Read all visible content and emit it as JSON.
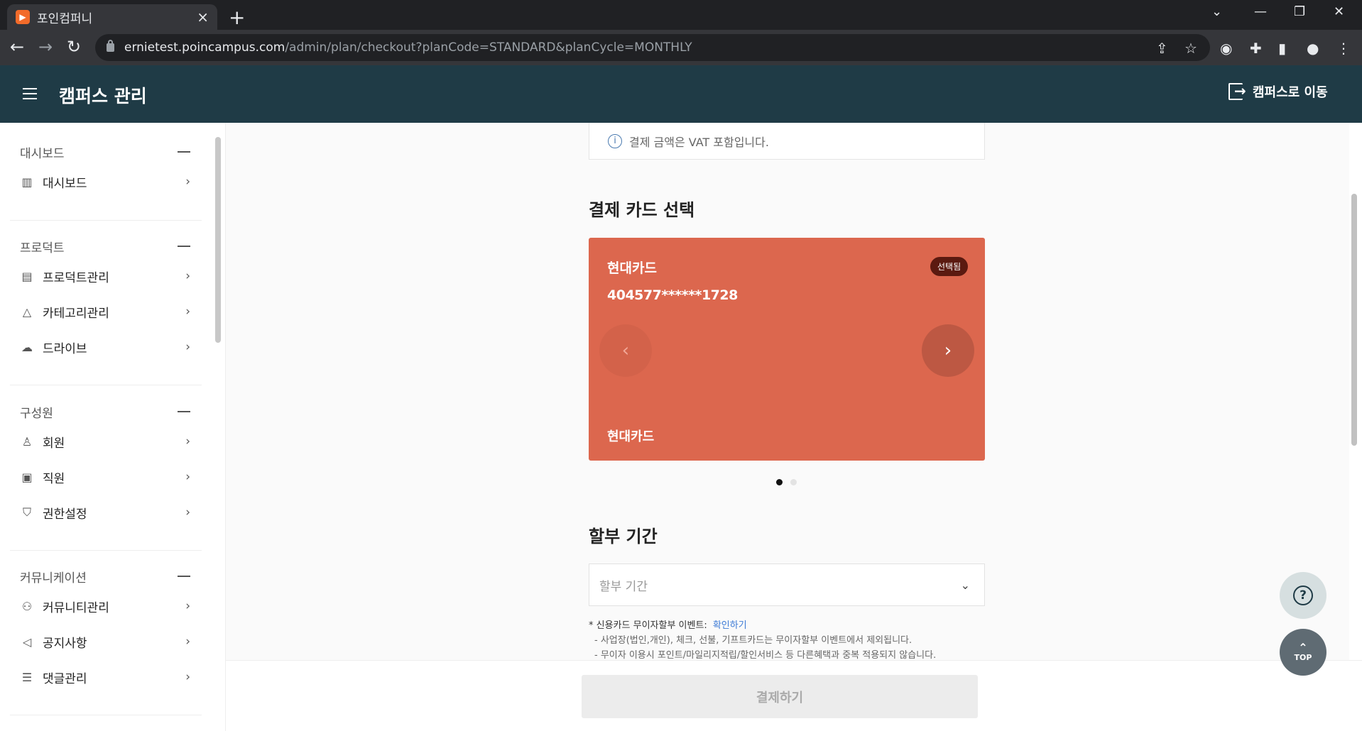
{
  "browser": {
    "tab_title": "포인컴퍼니",
    "url_host": "ernietest.poincampus.com",
    "url_path": "/admin/plan/checkout?planCode=STANDARD&planCycle=MONTHLY"
  },
  "header": {
    "title": "캠퍼스 관리",
    "goto_label": "캠퍼스로 이동"
  },
  "sidebar": {
    "groups": [
      {
        "title": "대시보드",
        "items": [
          {
            "label": "대시보드",
            "icon": "bar-chart-icon"
          }
        ]
      },
      {
        "title": "프로덕트",
        "items": [
          {
            "label": "프로덕트관리",
            "icon": "product-icon"
          },
          {
            "label": "카테고리관리",
            "icon": "category-icon"
          },
          {
            "label": "드라이브",
            "icon": "cloud-icon"
          }
        ]
      },
      {
        "title": "구성원",
        "items": [
          {
            "label": "회원",
            "icon": "member-icon"
          },
          {
            "label": "직원",
            "icon": "staff-icon"
          },
          {
            "label": "권한설정",
            "icon": "shield-icon"
          }
        ]
      },
      {
        "title": "커뮤니케이션",
        "items": [
          {
            "label": "커뮤니티관리",
            "icon": "community-icon"
          },
          {
            "label": "공지사항",
            "icon": "megaphone-icon"
          },
          {
            "label": "댓글관리",
            "icon": "comment-icon"
          }
        ]
      }
    ]
  },
  "main": {
    "vat_notice": "결제 금액은 VAT 포함입니다.",
    "card_section_title": "결제 카드 선택",
    "card": {
      "company": "현대카드",
      "number": "404577******1728",
      "badge": "선택됨",
      "bottom_name": "현대카드",
      "color": "#dc674e"
    },
    "carousel_active_index": 0,
    "installment_title": "할부 기간",
    "installment_placeholder": "할부 기간",
    "notice": {
      "title": "* 신용카드 무이자할부 이벤트:",
      "link": "확인하기",
      "line1": "- 사업장(법인,개인), 체크, 선불, 기프트카드는 무이자할부 이벤트에서 제외됩니다.",
      "line2": "- 무이자 이용시 포인트/마일리지적립/할인서비스 등 다른혜택과 중복 적용되지 않습니다."
    },
    "pay_button": "결제하기"
  },
  "floating": {
    "help_symbol": "?",
    "top_label": "TOP"
  },
  "colors": {
    "header_bg": "#1f3b46",
    "card_bg": "#dc674e"
  }
}
